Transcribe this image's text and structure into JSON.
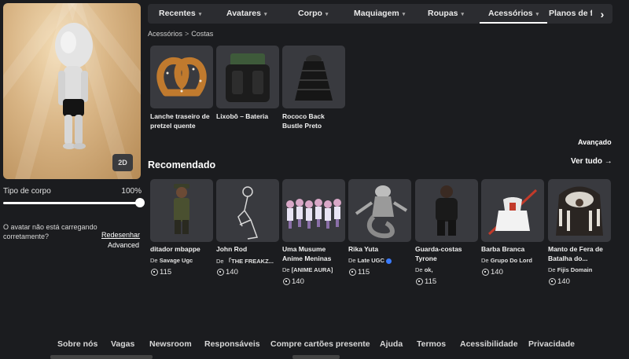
{
  "avatar": {
    "view_toggle": "2D"
  },
  "body_type": {
    "label": "Tipo de corpo",
    "value": "100%",
    "level": 1.0
  },
  "warning": {
    "text": "O avatar não está carregando corretamente?",
    "redraw": "Redesenhar",
    "advanced": "Advanced"
  },
  "tabs": [
    {
      "label": "Recentes",
      "chevron": "▾"
    },
    {
      "label": "Avatares",
      "chevron": "▾"
    },
    {
      "label": "Corpo",
      "chevron": "▾"
    },
    {
      "label": "Maquiagem",
      "chevron": "▾"
    },
    {
      "label": "Roupas",
      "chevron": "▾"
    },
    {
      "label": "Acessórios",
      "chevron": "▾"
    },
    {
      "label": "Planos de fu",
      "chevron": ""
    }
  ],
  "tab_next": "›",
  "breadcrumb": {
    "root": "Acessórios",
    "sep": ">",
    "current": "Costas"
  },
  "items": [
    {
      "name": "Lanche traseiro de pretzel quente"
    },
    {
      "name": "Lixobô – Bateria"
    },
    {
      "name": "Rococo Back Bustle Preto"
    }
  ],
  "advanced": "Avançado",
  "recommended": {
    "title": "Recomendado",
    "see_all": "Ver tudo →",
    "items": [
      {
        "name": "ditador mbappe",
        "by": "De",
        "creator": "Savage Ugc",
        "price": "115"
      },
      {
        "name": "John Rod",
        "by": "De",
        "creator": "「THE FREAKZ...",
        "price": "140"
      },
      {
        "name": "Uma Musume Anime Meninas",
        "by": "De",
        "creator": "[ANIME AURA]",
        "price": "140"
      },
      {
        "name": "Rika Yuta",
        "by": "De",
        "creator": "Late UGC",
        "price": "115",
        "verified": true
      },
      {
        "name": "Guarda-costas Tyrone",
        "by": "De",
        "creator": "ok,",
        "price": "115"
      },
      {
        "name": "Barba Branca",
        "by": "De",
        "creator": "Grupo Do Lord",
        "price": "140"
      },
      {
        "name": "Manto de Fera de Batalha do...",
        "by": "De",
        "creator": "Fijis Domain",
        "price": "140"
      }
    ]
  },
  "footer": [
    "Sobre nós",
    "Vagas",
    "Newsroom",
    "Responsáveis",
    "Compre cartões presente",
    "Ajuda",
    "Termos",
    "Acessibilidade",
    "Privacidade"
  ],
  "colors": {
    "background": "#1b1c1f",
    "bar": "#2b2c30",
    "card": "#393a3f",
    "verified": "#3a7bff"
  }
}
